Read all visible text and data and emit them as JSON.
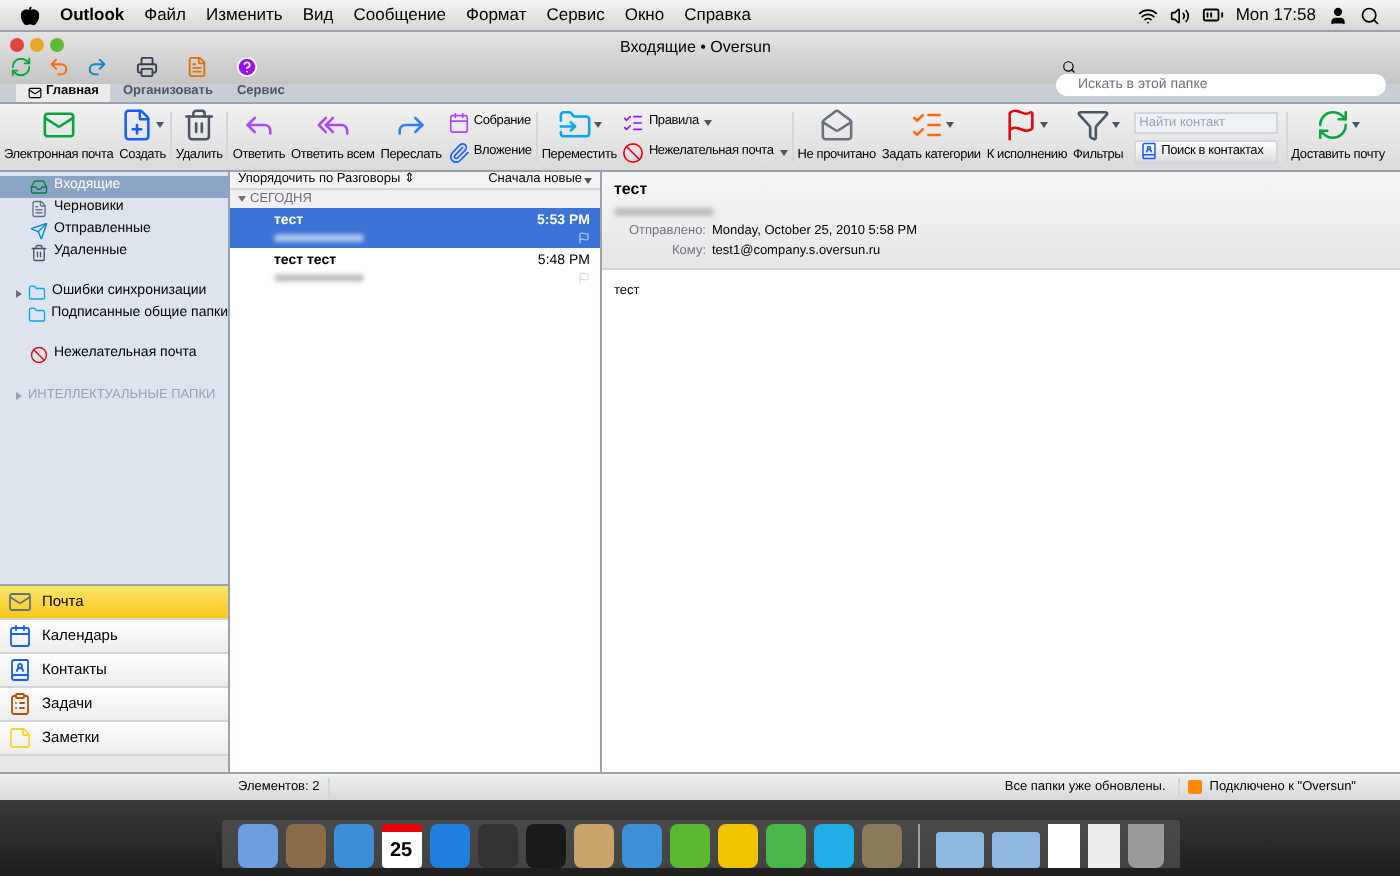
{
  "menu_bar": {
    "app": "Outlook",
    "items": [
      "Файл",
      "Изменить",
      "Вид",
      "Сообщение",
      "Формат",
      "Сервис",
      "Окно",
      "Справка"
    ],
    "clock": "Mon 17:58"
  },
  "window": {
    "title": "Входящие • Oversun",
    "search": {
      "placeholder": "Искать в этой папке"
    }
  },
  "ribbon_tabs": [
    {
      "label": "Главная",
      "selected": true
    },
    {
      "label": "Организовать",
      "selected": false
    },
    {
      "label": "Сервис",
      "selected": false
    }
  ],
  "ribbon": [
    {
      "kind": "large",
      "label": "Электронная почта",
      "dropdown": false
    },
    {
      "kind": "large",
      "label": "Создать",
      "dropdown": true
    },
    {
      "kind": "sep"
    },
    {
      "kind": "large",
      "label": "Удалить",
      "dropdown": false
    },
    {
      "kind": "sep"
    },
    {
      "kind": "large",
      "label": "Ответить",
      "dropdown": false
    },
    {
      "kind": "large",
      "label": "Ответить всем",
      "dropdown": false
    },
    {
      "kind": "large",
      "label": "Переслать",
      "dropdown": false
    },
    {
      "kind": "stack",
      "items": [
        {
          "label": "Собрание",
          "dropdown": false
        },
        {
          "label": "Вложение",
          "dropdown": false
        }
      ]
    },
    {
      "kind": "sep"
    },
    {
      "kind": "large",
      "label": "Переместить",
      "dropdown": true
    },
    {
      "kind": "stack",
      "items": [
        {
          "label": "Правила",
          "dropdown": true
        },
        {
          "label": "Нежелательная почта",
          "dropdown": true
        }
      ]
    },
    {
      "kind": "sep"
    },
    {
      "kind": "large",
      "label": "Не прочитано",
      "dropdown": false
    },
    {
      "kind": "large",
      "label": "Задать категории",
      "dropdown": true
    },
    {
      "kind": "large",
      "label": "К исполнению",
      "dropdown": true
    },
    {
      "kind": "large",
      "label": "Фильтры",
      "dropdown": true
    },
    {
      "kind": "contact",
      "placeholder": "Найти контакт",
      "button": "Поиск в контактах"
    },
    {
      "kind": "sep"
    },
    {
      "kind": "large",
      "label": "Доставить почту",
      "dropdown": true
    }
  ],
  "sidebar": {
    "folders": [
      {
        "kind": "folder",
        "label": "Входящие",
        "selected": true
      },
      {
        "kind": "folder",
        "label": "Черновики",
        "selected": false
      },
      {
        "kind": "folder",
        "label": "Отправленные",
        "selected": false
      },
      {
        "kind": "folder",
        "label": "Удаленные",
        "selected": false
      },
      {
        "kind": "gap"
      },
      {
        "kind": "folder",
        "label": "Ошибки синхронизации",
        "selected": false,
        "expanded": false
      },
      {
        "kind": "folder",
        "label": "Подписанные общие папки",
        "selected": false
      },
      {
        "kind": "gap"
      },
      {
        "kind": "folder",
        "label": "Нежелательная почта",
        "selected": false
      },
      {
        "kind": "gap"
      },
      {
        "kind": "section",
        "label": "ИНТЕЛЛЕКТУАЛЬНЫЕ ПАПКИ",
        "expanded": false
      }
    ],
    "nav": [
      {
        "label": "Почта",
        "selected": true
      },
      {
        "label": "Календарь",
        "selected": false
      },
      {
        "label": "Контакты",
        "selected": false
      },
      {
        "label": "Задачи",
        "selected": false
      },
      {
        "label": "Заметки",
        "selected": false
      }
    ]
  },
  "message_list": {
    "sort": "Упорядочить по Разговоры",
    "sort_arrows": "⇕",
    "order": "Сначала новые",
    "group": {
      "label": "СЕГОДНЯ",
      "expanded": true
    },
    "messages": [
      {
        "subject": "тест",
        "time": "5:53 PM",
        "selected": true
      },
      {
        "subject": "тест тест",
        "time": "5:48 PM",
        "selected": false
      }
    ]
  },
  "reading_pane": {
    "subject": "тест",
    "fields": [
      {
        "label": "Отправлено:",
        "value": "Monday, October 25, 2010 5:58 PM"
      },
      {
        "label": "Кому:",
        "value": "test1@company.s.oversun.ru"
      }
    ],
    "body": "тест"
  },
  "status_bar": {
    "count": "Элементов: 2",
    "sync": "Все папки уже обновлены.",
    "connection": "Подключено к \"Oversun\""
  },
  "dock": {
    "calendar_day": "25"
  }
}
